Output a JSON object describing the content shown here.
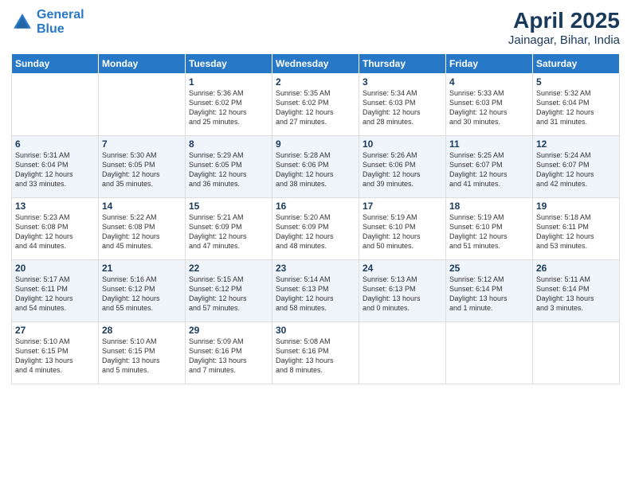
{
  "header": {
    "logo_line1": "General",
    "logo_line2": "Blue",
    "title": "April 2025",
    "subtitle": "Jainagar, Bihar, India"
  },
  "days_of_week": [
    "Sunday",
    "Monday",
    "Tuesday",
    "Wednesday",
    "Thursday",
    "Friday",
    "Saturday"
  ],
  "weeks": [
    [
      {
        "day": "",
        "detail": ""
      },
      {
        "day": "",
        "detail": ""
      },
      {
        "day": "1",
        "detail": "Sunrise: 5:36 AM\nSunset: 6:02 PM\nDaylight: 12 hours\nand 25 minutes."
      },
      {
        "day": "2",
        "detail": "Sunrise: 5:35 AM\nSunset: 6:02 PM\nDaylight: 12 hours\nand 27 minutes."
      },
      {
        "day": "3",
        "detail": "Sunrise: 5:34 AM\nSunset: 6:03 PM\nDaylight: 12 hours\nand 28 minutes."
      },
      {
        "day": "4",
        "detail": "Sunrise: 5:33 AM\nSunset: 6:03 PM\nDaylight: 12 hours\nand 30 minutes."
      },
      {
        "day": "5",
        "detail": "Sunrise: 5:32 AM\nSunset: 6:04 PM\nDaylight: 12 hours\nand 31 minutes."
      }
    ],
    [
      {
        "day": "6",
        "detail": "Sunrise: 5:31 AM\nSunset: 6:04 PM\nDaylight: 12 hours\nand 33 minutes."
      },
      {
        "day": "7",
        "detail": "Sunrise: 5:30 AM\nSunset: 6:05 PM\nDaylight: 12 hours\nand 35 minutes."
      },
      {
        "day": "8",
        "detail": "Sunrise: 5:29 AM\nSunset: 6:05 PM\nDaylight: 12 hours\nand 36 minutes."
      },
      {
        "day": "9",
        "detail": "Sunrise: 5:28 AM\nSunset: 6:06 PM\nDaylight: 12 hours\nand 38 minutes."
      },
      {
        "day": "10",
        "detail": "Sunrise: 5:26 AM\nSunset: 6:06 PM\nDaylight: 12 hours\nand 39 minutes."
      },
      {
        "day": "11",
        "detail": "Sunrise: 5:25 AM\nSunset: 6:07 PM\nDaylight: 12 hours\nand 41 minutes."
      },
      {
        "day": "12",
        "detail": "Sunrise: 5:24 AM\nSunset: 6:07 PM\nDaylight: 12 hours\nand 42 minutes."
      }
    ],
    [
      {
        "day": "13",
        "detail": "Sunrise: 5:23 AM\nSunset: 6:08 PM\nDaylight: 12 hours\nand 44 minutes."
      },
      {
        "day": "14",
        "detail": "Sunrise: 5:22 AM\nSunset: 6:08 PM\nDaylight: 12 hours\nand 45 minutes."
      },
      {
        "day": "15",
        "detail": "Sunrise: 5:21 AM\nSunset: 6:09 PM\nDaylight: 12 hours\nand 47 minutes."
      },
      {
        "day": "16",
        "detail": "Sunrise: 5:20 AM\nSunset: 6:09 PM\nDaylight: 12 hours\nand 48 minutes."
      },
      {
        "day": "17",
        "detail": "Sunrise: 5:19 AM\nSunset: 6:10 PM\nDaylight: 12 hours\nand 50 minutes."
      },
      {
        "day": "18",
        "detail": "Sunrise: 5:19 AM\nSunset: 6:10 PM\nDaylight: 12 hours\nand 51 minutes."
      },
      {
        "day": "19",
        "detail": "Sunrise: 5:18 AM\nSunset: 6:11 PM\nDaylight: 12 hours\nand 53 minutes."
      }
    ],
    [
      {
        "day": "20",
        "detail": "Sunrise: 5:17 AM\nSunset: 6:11 PM\nDaylight: 12 hours\nand 54 minutes."
      },
      {
        "day": "21",
        "detail": "Sunrise: 5:16 AM\nSunset: 6:12 PM\nDaylight: 12 hours\nand 55 minutes."
      },
      {
        "day": "22",
        "detail": "Sunrise: 5:15 AM\nSunset: 6:12 PM\nDaylight: 12 hours\nand 57 minutes."
      },
      {
        "day": "23",
        "detail": "Sunrise: 5:14 AM\nSunset: 6:13 PM\nDaylight: 12 hours\nand 58 minutes."
      },
      {
        "day": "24",
        "detail": "Sunrise: 5:13 AM\nSunset: 6:13 PM\nDaylight: 13 hours\nand 0 minutes."
      },
      {
        "day": "25",
        "detail": "Sunrise: 5:12 AM\nSunset: 6:14 PM\nDaylight: 13 hours\nand 1 minute."
      },
      {
        "day": "26",
        "detail": "Sunrise: 5:11 AM\nSunset: 6:14 PM\nDaylight: 13 hours\nand 3 minutes."
      }
    ],
    [
      {
        "day": "27",
        "detail": "Sunrise: 5:10 AM\nSunset: 6:15 PM\nDaylight: 13 hours\nand 4 minutes."
      },
      {
        "day": "28",
        "detail": "Sunrise: 5:10 AM\nSunset: 6:15 PM\nDaylight: 13 hours\nand 5 minutes."
      },
      {
        "day": "29",
        "detail": "Sunrise: 5:09 AM\nSunset: 6:16 PM\nDaylight: 13 hours\nand 7 minutes."
      },
      {
        "day": "30",
        "detail": "Sunrise: 5:08 AM\nSunset: 6:16 PM\nDaylight: 13 hours\nand 8 minutes."
      },
      {
        "day": "",
        "detail": ""
      },
      {
        "day": "",
        "detail": ""
      },
      {
        "day": "",
        "detail": ""
      }
    ]
  ]
}
